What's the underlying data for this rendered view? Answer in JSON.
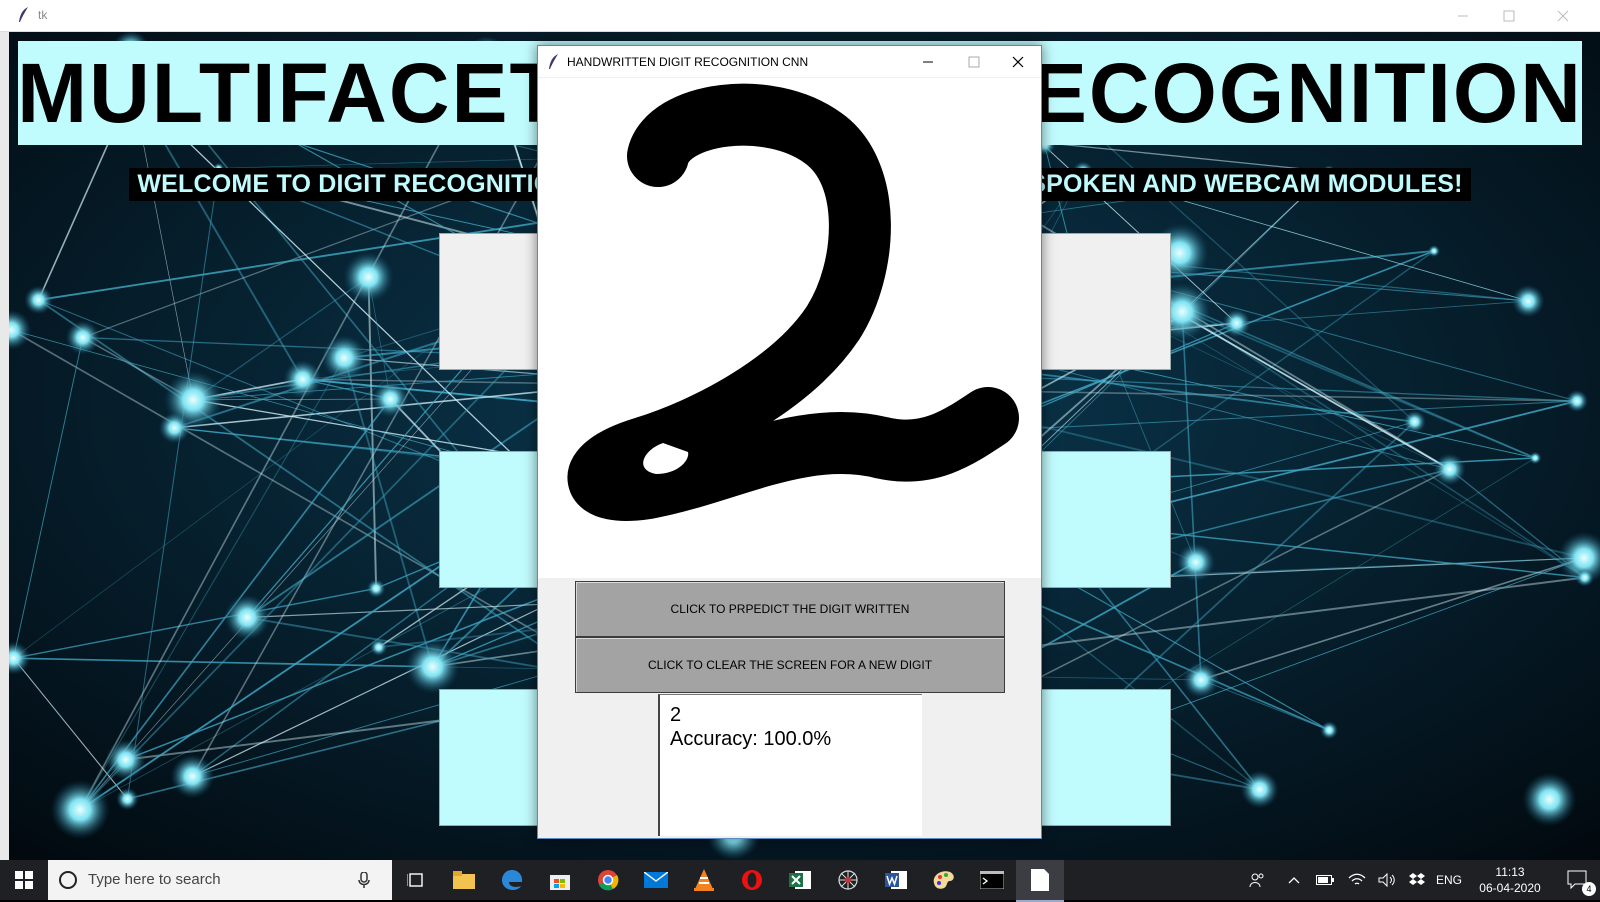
{
  "main_window": {
    "title": "tk",
    "banner_title": "MULTIFACETED DIGIT RECOGNITION",
    "welcome_text": "WELCOME TO DIGIT RECOGNITION APPLICATION WITH HANDWRITTEN, SPOKEN AND WEBCAM MODULES!",
    "colors": {
      "banner": "#c0fbfd",
      "background": "#020b14"
    }
  },
  "dialog": {
    "title": "HANDWRITTEN DIGIT RECOGNITION CNN",
    "canvas_content": "handwritten digit 2",
    "predict_button": "CLICK TO PRPEDICT THE DIGIT WRITTEN",
    "clear_button": "CLICK TO CLEAR THE SCREEN FOR A NEW DIGIT",
    "result": {
      "digit": "2",
      "accuracy": "Accuracy: 100.0%"
    }
  },
  "taskbar": {
    "search_placeholder": "Type here to search",
    "pinned": [
      "task-view-icon",
      "file-explorer-icon",
      "edge-icon",
      "store-icon",
      "chrome-icon",
      "mail-icon",
      "vlc-icon",
      "opera-icon",
      "excel-icon",
      "spider-icon",
      "word-icon",
      "paint-icon",
      "terminal-icon",
      "notepad-icon"
    ],
    "language": "ENG",
    "time": "11:13",
    "date": "06-04-2020",
    "notification_count": "4"
  }
}
